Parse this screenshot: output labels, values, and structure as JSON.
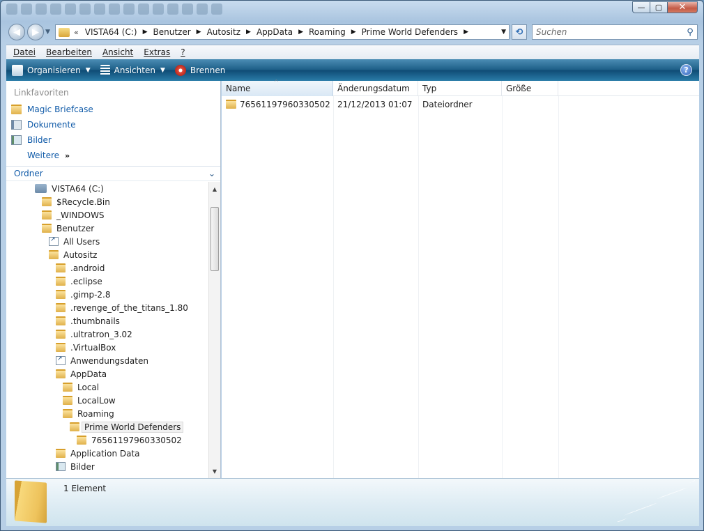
{
  "window": {
    "caption_buttons": [
      "—",
      "▢",
      "✕"
    ]
  },
  "address": {
    "overflow": "«",
    "crumbs": [
      "VISTA64 (C:)",
      "Benutzer",
      "Autositz",
      "AppData",
      "Roaming",
      "Prime World Defenders"
    ],
    "separator": "▶",
    "dropdown": "▼"
  },
  "refresh_icon": "⟲",
  "search": {
    "placeholder": "Suchen",
    "icon": "⚲"
  },
  "menu": [
    "Datei",
    "Bearbeiten",
    "Ansicht",
    "Extras",
    "?"
  ],
  "commands": {
    "organize": "Organisieren",
    "views": "Ansichten",
    "burn": "Brennen",
    "caret": "▼",
    "help": "?"
  },
  "favorites": {
    "header": "Linkfavoriten",
    "items": [
      "Magic Briefcase",
      "Dokumente",
      "Bilder",
      "Weitere"
    ],
    "more_glyph": "»"
  },
  "folders": {
    "header": "Ordner",
    "chevron": "⌄",
    "tree": [
      {
        "label": "VISTA64 (C:)",
        "level": 0,
        "icon": "drive-icon"
      },
      {
        "label": "$Recycle.Bin",
        "level": 1,
        "icon": "folder-icon"
      },
      {
        "label": "_WINDOWS",
        "level": 1,
        "icon": "folder-icon"
      },
      {
        "label": "Benutzer",
        "level": 1,
        "icon": "folder-icon"
      },
      {
        "label": "All Users",
        "level": 2,
        "icon": "shortcut-folder-icon"
      },
      {
        "label": "Autositz",
        "level": 2,
        "icon": "folder-icon"
      },
      {
        "label": ".android",
        "level": 3,
        "icon": "folder-icon"
      },
      {
        "label": ".eclipse",
        "level": 3,
        "icon": "folder-icon"
      },
      {
        "label": ".gimp-2.8",
        "level": 3,
        "icon": "folder-icon"
      },
      {
        "label": ".revenge_of_the_titans_1.80",
        "level": 3,
        "icon": "folder-icon"
      },
      {
        "label": ".thumbnails",
        "level": 3,
        "icon": "folder-icon"
      },
      {
        "label": ".ultratron_3.02",
        "level": 3,
        "icon": "folder-icon"
      },
      {
        "label": ".VirtualBox",
        "level": 3,
        "icon": "folder-icon"
      },
      {
        "label": "Anwendungsdaten",
        "level": 3,
        "icon": "shortcut-folder-icon"
      },
      {
        "label": "AppData",
        "level": 3,
        "icon": "folder-icon"
      },
      {
        "label": "Local",
        "level": 4,
        "icon": "folder-icon"
      },
      {
        "label": "LocalLow",
        "level": 4,
        "icon": "folder-icon"
      },
      {
        "label": "Roaming",
        "level": 4,
        "icon": "folder-icon"
      },
      {
        "label": "Prime World Defenders",
        "level": 5,
        "icon": "folder-icon",
        "selected": true
      },
      {
        "label": "76561197960330502",
        "level": 6,
        "icon": "folder-icon"
      },
      {
        "label": "Application Data",
        "level": 3,
        "icon": "folder-icon"
      },
      {
        "label": "Bilder",
        "level": 3,
        "icon": "pictures-icon"
      }
    ],
    "scroll_up": "▲",
    "scroll_down": "▼"
  },
  "columns": {
    "name": "Name",
    "date": "Änderungsdatum",
    "type": "Typ",
    "size": "Größe",
    "sort_glyph": "^"
  },
  "files": [
    {
      "name": "76561197960330502",
      "date": "21/12/2013 01:07",
      "type": "Dateiordner",
      "size": ""
    }
  ],
  "status": {
    "count": "1 Element"
  }
}
